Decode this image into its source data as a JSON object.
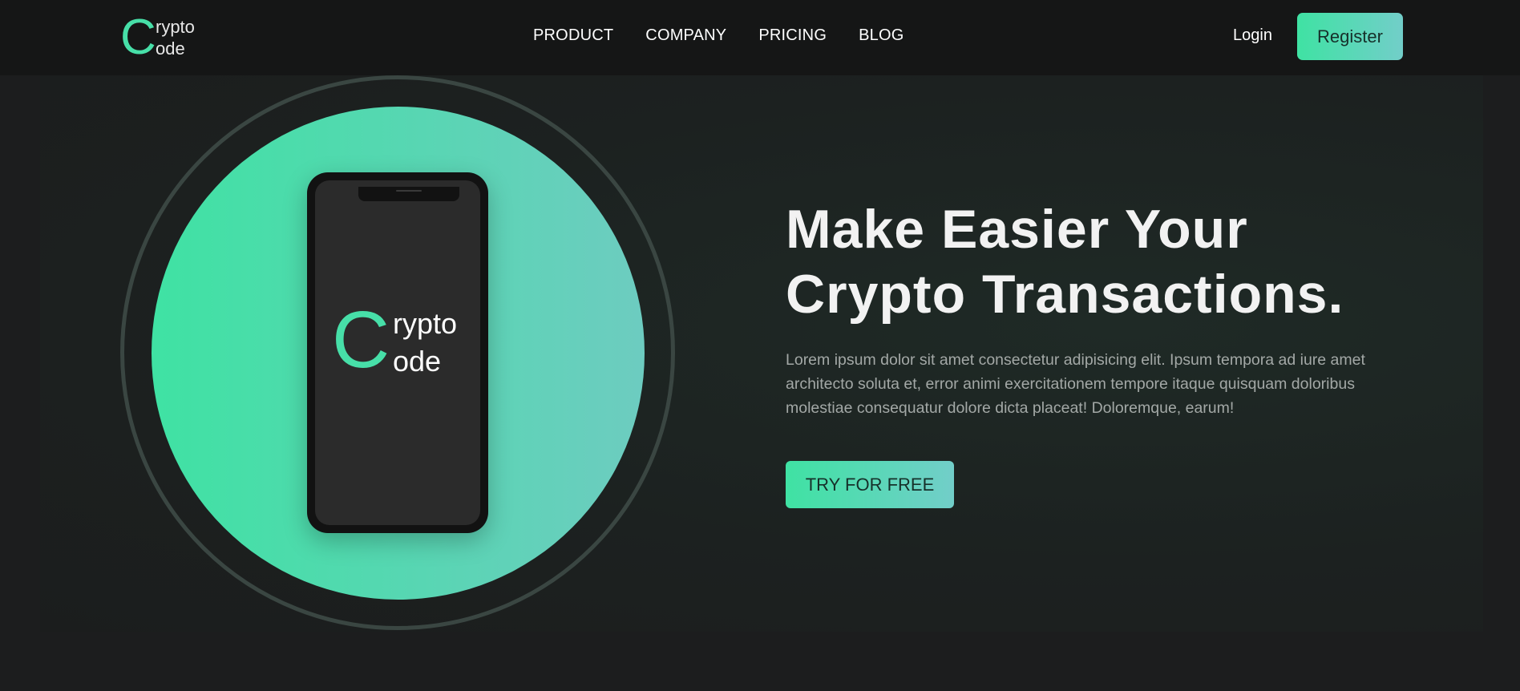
{
  "brand": {
    "logo_letter": "C",
    "logo_line1": "rypto",
    "logo_line2": "ode"
  },
  "nav": {
    "items": [
      {
        "label": "PRODUCT"
      },
      {
        "label": "COMPANY"
      },
      {
        "label": "PRICING"
      },
      {
        "label": "BLOG"
      }
    ],
    "login_label": "Login",
    "register_label": "Register"
  },
  "hero": {
    "headline_line1": "Make Easier Your",
    "headline_line2": "Crypto Transactions.",
    "description": "Lorem ipsum dolor sit amet consectetur adipisicing elit. Ipsum tempora ad iure amet architecto soluta et, error animi exercitationem tempore itaque quisquam doloribus molestiae consequatur dolore dicta placeat! Doloremque, earum!",
    "cta_label": "TRY FOR FREE"
  },
  "phone": {
    "logo_letter": "C",
    "logo_line1": "rypto",
    "logo_line2": "ode"
  },
  "colors": {
    "accent": "#3fe2a3",
    "accent_end": "#72cec9",
    "background": "#1c1d1e",
    "header_bg": "#151616"
  }
}
